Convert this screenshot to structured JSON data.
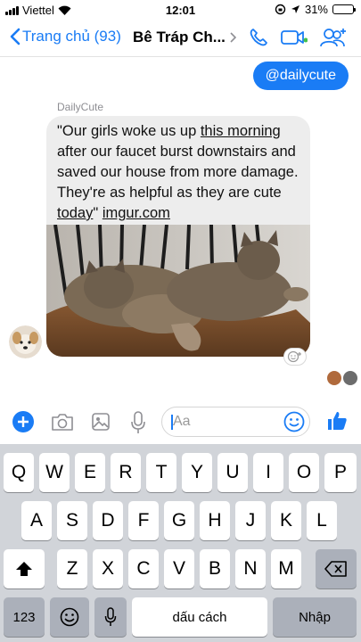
{
  "status_bar": {
    "carrier": "Viettel",
    "time": "12:01",
    "battery": "31%",
    "battery_level": 0.31
  },
  "nav": {
    "back_label": "Trang chủ (93)",
    "title": "Bê Tráp Ch...",
    "icons": [
      "chevron-left-icon",
      "chevron-right-icon",
      "phone-icon",
      "video-icon",
      "add-people-icon"
    ]
  },
  "messages": {
    "outgoing_text": "@dailycute",
    "sender_name": "DailyCute",
    "shared_post": {
      "text_1": "\"Our girls woke us up ",
      "link_1": "this morning",
      "text_2": " after our faucet burst downstairs and saved our house from more damage. They're as helpful as they are cute ",
      "link_2": "today",
      "text_3": "\" ",
      "link_3": "imgur.com"
    }
  },
  "composer": {
    "placeholder": "Aa",
    "icons": [
      "plus-icon",
      "camera-icon",
      "image-icon",
      "microphone-icon",
      "emoji-icon",
      "thumbs-up-icon"
    ]
  },
  "keyboard": {
    "row1": [
      "Q",
      "W",
      "E",
      "R",
      "T",
      "Y",
      "U",
      "I",
      "O",
      "P"
    ],
    "row2": [
      "A",
      "S",
      "D",
      "F",
      "G",
      "H",
      "J",
      "K",
      "L"
    ],
    "row3": [
      "Z",
      "X",
      "C",
      "V",
      "B",
      "N",
      "M"
    ],
    "numbers_label": "123",
    "space_label": "dấu cách",
    "return_label": "Nhập"
  },
  "colors": {
    "accent": "#1a7cf5",
    "bubble_incoming": "#ededed",
    "keyboard_bg": "#d1d4d9"
  }
}
